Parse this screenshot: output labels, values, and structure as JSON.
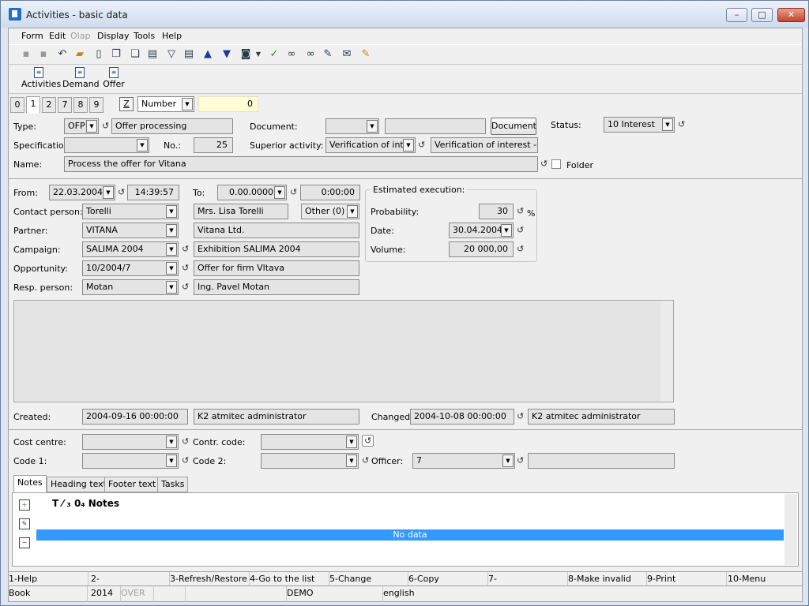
{
  "window": {
    "title": "Activities - basic data",
    "min": "–",
    "max": "□",
    "close": "✕"
  },
  "menu": [
    "Form",
    "Edit",
    "Olap",
    "Display",
    "Tools",
    "Help"
  ],
  "toolbar2": [
    "Activities",
    "Demand",
    "Offer"
  ],
  "tabs": [
    "0",
    "1",
    "2",
    "7",
    "8",
    "9"
  ],
  "tabrow": {
    "z": "Z",
    "sort": "Number",
    "num": "0"
  },
  "head": {
    "type_label": "Type:",
    "type_code": "OFP",
    "type_name": "Offer processing",
    "document_label": "Document:",
    "document_btn": "Document",
    "status_label": "Status:",
    "status_value": "10 Interest",
    "spec_label": "Specification:",
    "no_label": "No.:",
    "no_value": "25",
    "superior_label": "Superior activity:",
    "superior_code": "Verification of inter",
    "superior_text": "Verification of interest - yes",
    "name_label": "Name:",
    "name_value": "Process the offer for Vitana",
    "folder_label": "Folder"
  },
  "detail": {
    "from_label": "From:",
    "from_date": "22.03.2004",
    "from_time": "14:39:57",
    "to_label": "To:",
    "to_date": "0.00.0000",
    "to_time": "0:00:00",
    "contact_label": "Contact person:",
    "contact_code": "Torelli",
    "contact_name": "Mrs. Lisa Torelli",
    "other": "Other (0)",
    "partner_label": "Partner:",
    "partner_code": "VITANA",
    "partner_name": "Vitana Ltd.",
    "campaign_label": "Campaign:",
    "campaign_code": "SALIMA 2004",
    "campaign_name": "Exhibition SALIMA 2004",
    "opportunity_label": "Opportunity:",
    "opportunity_code": "10/2004/7",
    "opportunity_name": "Offer for firm Vltava",
    "resp_label": "Resp. person:",
    "resp_code": "Motan",
    "resp_name": "Ing. Pavel Motan"
  },
  "estimated": {
    "title": "Estimated execution:",
    "prob_label": "Probability:",
    "prob_value": "30",
    "prob_unit": "%",
    "date_label": "Date:",
    "date_value": "30.04.2004",
    "volume_label": "Volume:",
    "volume_value": "20 000,00"
  },
  "audit": {
    "created_label": "Created:",
    "created_value": "2004-09-16 00:00:00",
    "created_by": "K2 atmitec administrator",
    "changed_label": "Changed:",
    "changed_value": "2004-10-08 00:00:00",
    "changed_by": "K2 atmitec administrator"
  },
  "codes": {
    "cost_label": "Cost centre:",
    "contr_label": "Contr. code:",
    "code1_label": "Code 1:",
    "code2_label": "Code 2:",
    "officer_label": "Officer:",
    "officer_value": "7"
  },
  "bottom_tabs": [
    "Notes",
    "Heading text",
    "Footer text",
    "Tasks"
  ],
  "notes": {
    "header": "T ⁄ ₃ 0₄ Notes",
    "empty": "No data"
  },
  "fkeys": [
    "1-Help",
    "2-",
    "3-Refresh/Restore",
    "4-Go to the list",
    "5-Change",
    "6-Copy",
    "7-",
    "8-Make invalid",
    "9-Print",
    "10-Menu"
  ],
  "status": {
    "mode": "Book",
    "year": "2014",
    "over": "OVER",
    "db": "DEMO",
    "lang": "english"
  }
}
